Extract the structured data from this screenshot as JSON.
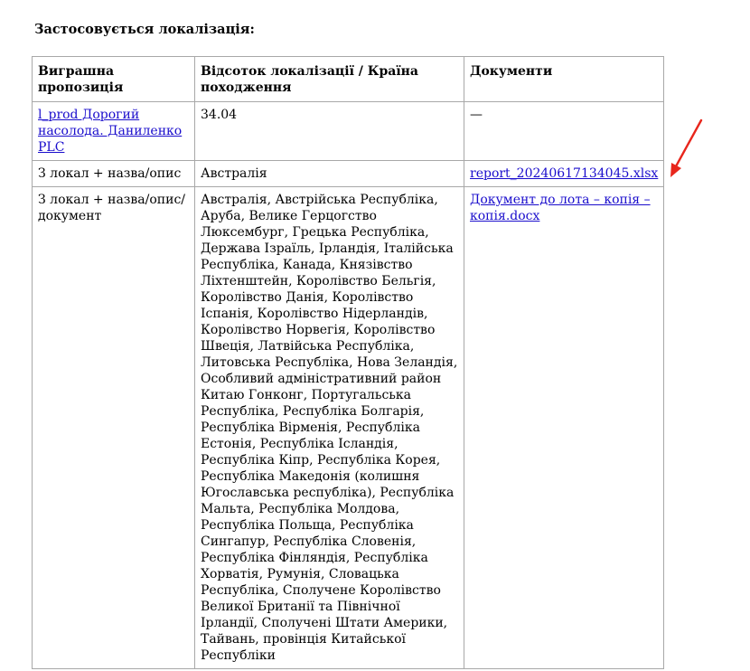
{
  "heading": "Застосовується локалізація:",
  "table": {
    "headers": {
      "offer": "Виграшна пропозиція",
      "percent": "Відсоток локалізації / Країна походження",
      "documents": "Документи"
    },
    "rows": [
      {
        "offer": "l_prod Дорогий насолода. Даниленко PLC",
        "percent": "34.04",
        "documents": "—"
      },
      {
        "offer": "З локал + назва/опис",
        "percent": "Австралія",
        "documents": "report_20240617134045.xlsx"
      },
      {
        "offer": "З локал + назва/опис/документ",
        "percent": "Австралія, Австрійська Республіка, Аруба, Велике Герцогство Люксембург, Грецька Республіка, Держава Ізраїль, Ірландія, Італійська Республіка, Канада, Князівство Ліхтенштейн, Королівство Бельгія, Королівство Данія, Королівство Іспанія, Королівство Нідерландів, Королівство Норвегія, Королівство Швеція, Латвійська Республіка, Литовська Республіка, Нова Зеландія, Особливий адміністративний район Китаю Гонконг, Португальська Республіка, Республіка Болгарія, Республіка Вірменія, Республіка Естонія, Республіка Ісландія, Республіка Кіпр, Республіка Корея, Республіка Македонія (колишня Югославська республіка), Республіка Мальта, Республіка Молдова, Республіка Польща, Республіка Сингапур, Республіка Словенія, Республіка Фінляндія, Республіка Хорватія, Румунія, Словацька Республіка, Сполучене Королівство Великої Британії та Північної Ірландії, Сполучені Штати Америки, Тайвань, провінція Китайської Республіки",
        "documents": "Документ до лота – копія – копія.docx"
      }
    ]
  },
  "colors": {
    "link": "#1a0dcc",
    "border": "#a8a8a8",
    "annotation_arrow": "#e8261c"
  },
  "annotation": {
    "icon": "red-arrow-icon"
  }
}
